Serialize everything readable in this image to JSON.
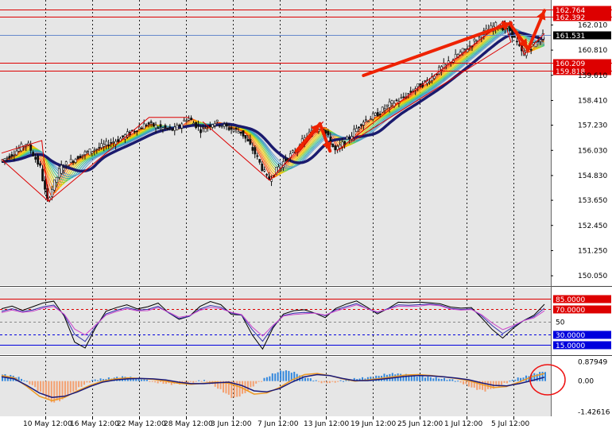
{
  "chart_data": [
    {
      "type": "line",
      "panel": "price",
      "ylim": [
        149.6,
        163.2
      ],
      "y_ticks": [
        "162.010",
        "160.810",
        "159.610",
        "158.410",
        "157.230",
        "156.030",
        "154.830",
        "153.650",
        "152.450",
        "151.250",
        "150.050"
      ],
      "y_tick_values": [
        162.01,
        160.81,
        159.61,
        158.41,
        157.23,
        156.03,
        154.83,
        153.65,
        152.45,
        151.25,
        150.05
      ],
      "current_price": 161.531,
      "current_price_label": "161.531",
      "levels": [
        {
          "value": 162.764,
          "label": "162.764"
        },
        {
          "value": 162.392,
          "label": "162.392"
        },
        {
          "value": 160.209,
          "label": "160.209"
        },
        {
          "value": 159.818,
          "label": "159.818"
        }
      ],
      "price_path": [
        [
          0,
          155.5
        ],
        [
          2,
          155.9
        ],
        [
          4,
          156.4
        ],
        [
          6,
          155.2
        ],
        [
          7,
          153.6
        ],
        [
          9,
          155.2
        ],
        [
          12,
          155.8
        ],
        [
          15,
          156.2
        ],
        [
          18,
          156.6
        ],
        [
          20,
          157.0
        ],
        [
          22,
          157.3
        ],
        [
          24,
          157.1
        ],
        [
          26,
          157.0
        ],
        [
          28,
          157.6
        ],
        [
          30,
          157.0
        ],
        [
          32,
          157.4
        ],
        [
          34,
          157.1
        ],
        [
          36,
          156.9
        ],
        [
          38,
          155.9
        ],
        [
          40,
          154.6
        ],
        [
          42,
          155.4
        ],
        [
          44,
          156.0
        ],
        [
          46,
          156.8
        ],
        [
          48,
          157.2
        ],
        [
          50,
          156.0
        ],
        [
          52,
          156.6
        ],
        [
          54,
          157.4
        ],
        [
          56,
          157.7
        ],
        [
          58,
          158.2
        ],
        [
          60,
          158.5
        ],
        [
          62,
          159.0
        ],
        [
          64,
          159.4
        ],
        [
          66,
          160.0
        ],
        [
          68,
          160.5
        ],
        [
          70,
          161.0
        ],
        [
          72,
          161.6
        ],
        [
          74,
          162.0
        ],
        [
          76,
          161.8
        ],
        [
          77,
          161.2
        ],
        [
          78,
          160.6
        ],
        [
          79,
          160.9
        ],
        [
          80,
          161.2
        ],
        [
          81,
          161.5
        ]
      ],
      "annotations": {
        "channel_color": "#dd0000",
        "arrow_color": "#ee2200"
      }
    },
    {
      "type": "line",
      "panel": "oscillator",
      "ylim": [
        0,
        100
      ],
      "levels": [
        {
          "value": 85,
          "label": "85.0000",
          "color": "#dd0000"
        },
        {
          "value": 70,
          "label": "70.0000",
          "color": "#dd0000"
        },
        {
          "value": 50,
          "label": "50",
          "color": "#888888"
        },
        {
          "value": 30,
          "label": "30.0000",
          "color": "#0000dd"
        },
        {
          "value": 15,
          "label": "15.0000",
          "color": "#0000dd"
        }
      ],
      "series": [
        {
          "color": "#000000",
          "values": [
            70,
            72,
            68,
            75,
            78,
            80,
            60,
            20,
            8,
            40,
            68,
            72,
            74,
            70,
            75,
            78,
            62,
            55,
            60,
            72,
            80,
            78,
            62,
            58,
            30,
            10,
            40,
            60,
            68,
            70,
            62,
            55,
            72,
            78,
            80,
            72,
            64,
            70,
            78,
            80,
            82,
            78,
            76,
            74,
            72,
            70,
            55,
            40,
            25,
            38,
            52,
            62,
            76
          ]
        },
        {
          "color": "#3333aa",
          "values": [
            66,
            68,
            66,
            70,
            72,
            74,
            62,
            32,
            18,
            42,
            64,
            68,
            70,
            68,
            71,
            73,
            62,
            56,
            60,
            68,
            74,
            74,
            64,
            58,
            38,
            22,
            42,
            58,
            64,
            66,
            62,
            58,
            70,
            74,
            76,
            70,
            66,
            70,
            74,
            76,
            78,
            76,
            74,
            72,
            70,
            68,
            58,
            46,
            32,
            40,
            52,
            60,
            70
          ]
        },
        {
          "color": "#cc44cc",
          "values": [
            64,
            66,
            65,
            68,
            70,
            72,
            63,
            40,
            28,
            44,
            62,
            66,
            68,
            67,
            69,
            71,
            63,
            58,
            61,
            66,
            71,
            72,
            65,
            59,
            42,
            30,
            44,
            57,
            62,
            64,
            62,
            59,
            68,
            72,
            74,
            70,
            67,
            69,
            72,
            74,
            76,
            75,
            73,
            71,
            69,
            67,
            60,
            50,
            38,
            42,
            52,
            58,
            66
          ]
        }
      ]
    },
    {
      "type": "bar",
      "panel": "macd",
      "ylim": [
        -1.55,
        1.05
      ],
      "y_ticks": [
        "0.87949",
        "0.00",
        "-1.42616"
      ],
      "y_tick_values": [
        0.87949,
        0,
        -1.42616
      ],
      "x_tick_labels": [
        "10 May 12:00",
        "16 May 12:00",
        "22 May 12:00",
        "28 May 12:00",
        "3 Jun 12:00",
        "7 Jun 12:00",
        "13 Jun 12:00",
        "19 Jun 12:00",
        "25 Jun 12:00",
        "1 Jul 12:00",
        "5 Jul 12:00"
      ],
      "histogram": [
        0.3,
        0.25,
        0.1,
        -0.2,
        -0.6,
        -1.0,
        -0.85,
        -0.5,
        -0.2,
        0.05,
        0.1,
        0.15,
        0.2,
        0.15,
        0.1,
        -0.05,
        -0.1,
        -0.15,
        -0.1,
        -0.05,
        0.05,
        -0.2,
        -0.5,
        -0.8,
        -0.6,
        -0.2,
        0.1,
        0.35,
        0.5,
        0.4,
        0.2,
        0.05,
        -0.1,
        -0.05,
        0.05,
        0.1,
        0.15,
        0.2,
        0.3,
        0.35,
        0.3,
        0.25,
        0.2,
        0.15,
        0.1,
        0.05,
        -0.15,
        -0.35,
        -0.45,
        -0.3,
        -0.1,
        0.1,
        0.2,
        0.35,
        0.45
      ],
      "signal_line": [
        0.2,
        0.1,
        -0.2,
        -0.55,
        -0.75,
        -0.7,
        -0.5,
        -0.25,
        -0.05,
        0.05,
        0.1,
        0.12,
        0.1,
        0.05,
        -0.05,
        -0.12,
        -0.12,
        -0.08,
        -0.05,
        -0.2,
        -0.45,
        -0.5,
        -0.35,
        -0.05,
        0.2,
        0.3,
        0.25,
        0.12,
        0.02,
        0.02,
        0.08,
        0.15,
        0.22,
        0.26,
        0.24,
        0.2,
        0.14,
        0.06,
        -0.08,
        -0.2,
        -0.22,
        -0.12,
        0.02,
        0.18
      ],
      "macd_line": [
        0.25,
        0.15,
        -0.25,
        -0.7,
        -0.9,
        -0.75,
        -0.45,
        -0.2,
        0,
        0.1,
        0.15,
        0.12,
        0.08,
        0,
        -0.1,
        -0.15,
        -0.1,
        -0.05,
        -0.1,
        -0.3,
        -0.6,
        -0.55,
        -0.3,
        0.05,
        0.3,
        0.35,
        0.25,
        0.1,
        0,
        0.05,
        0.12,
        0.2,
        0.28,
        0.3,
        0.26,
        0.2,
        0.12,
        0.02,
        -0.15,
        -0.3,
        -0.25,
        -0.05,
        0.2,
        0.35
      ],
      "pos_color": "#3388dd",
      "neg_color": "#f4a070",
      "signal_color": "#1a1a7a",
      "macd_color": "#ee9922"
    }
  ]
}
